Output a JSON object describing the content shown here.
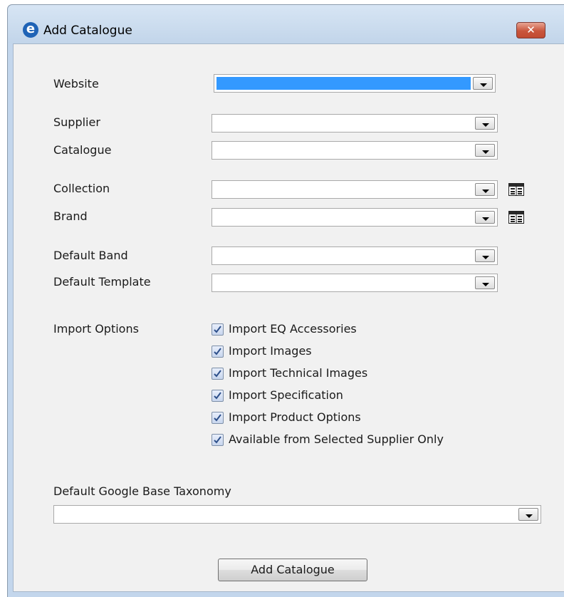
{
  "window": {
    "title": "Add Catalogue",
    "logo_letter": "e",
    "close_glyph": "✕"
  },
  "form": {
    "website_label": "Website",
    "website_value": "",
    "supplier_label": "Supplier",
    "supplier_value": "",
    "catalogue_label": "Catalogue",
    "catalogue_value": "",
    "collection_label": "Collection",
    "collection_value": "",
    "brand_label": "Brand",
    "brand_value": "",
    "default_band_label": "Default Band",
    "default_band_value": "",
    "default_template_label": "Default Template",
    "default_template_value": "",
    "import_options_label": "Import Options",
    "import_options": [
      {
        "label": "Import EQ Accessories",
        "checked": true
      },
      {
        "label": "Import Images",
        "checked": true
      },
      {
        "label": "Import Technical Images",
        "checked": true
      },
      {
        "label": "Import Specification",
        "checked": true
      },
      {
        "label": "Import Product Options",
        "checked": true
      },
      {
        "label": "Available from Selected Supplier Only",
        "checked": true
      }
    ],
    "taxonomy_label": "Default Google Base Taxonomy",
    "taxonomy_value": ""
  },
  "actions": {
    "add_catalogue_label": "Add Catalogue"
  },
  "icons": {
    "dropdown": "chevron-down-icon",
    "lookup": "grid-lookup-icon",
    "checkbox": "checkmark-icon"
  },
  "colors": {
    "selection": "#3399ff",
    "titlebar": "#c3d6ec",
    "close_button": "#c9553c",
    "logo": "#1f63b6"
  }
}
